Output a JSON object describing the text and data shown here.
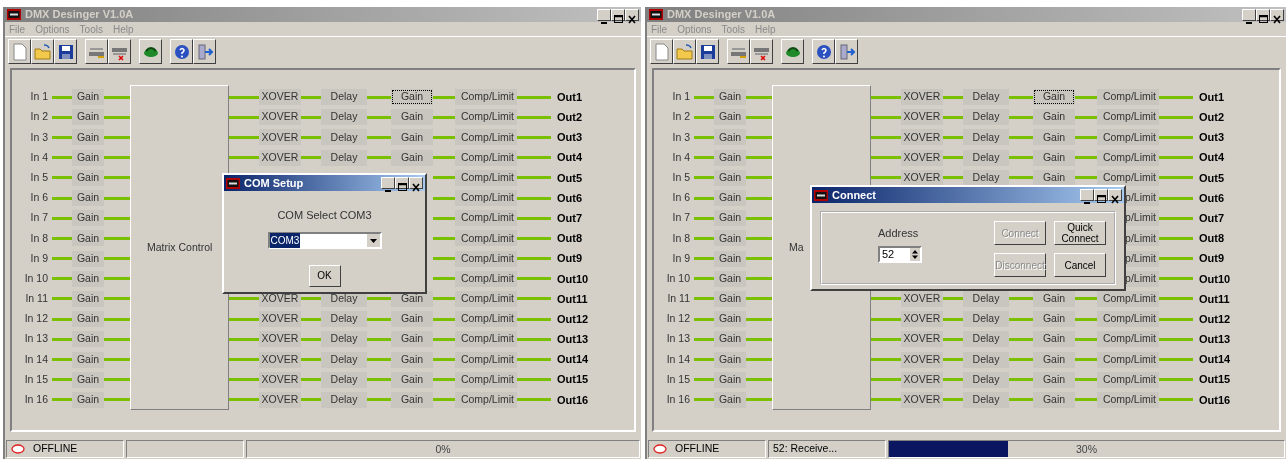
{
  "windows": [
    {
      "title": "DMX Desinger V1.0A",
      "menu": [
        {
          "label": "File",
          "disabled": true
        },
        {
          "label": "Options",
          "disabled": true
        },
        {
          "label": "Tools",
          "disabled": true
        },
        {
          "label": "Help",
          "disabled": true
        }
      ],
      "toolbar": [
        [
          {
            "kind": "new"
          },
          {
            "kind": "open"
          },
          {
            "kind": "save"
          }
        ],
        [
          {
            "kind": "connect"
          },
          {
            "kind": "disconnect"
          }
        ],
        [
          {
            "kind": "transfer"
          }
        ],
        [
          {
            "kind": "help"
          },
          {
            "kind": "exit"
          }
        ]
      ],
      "matrix_label": "Matrix Control",
      "rows": [
        {
          "input": "In 1",
          "gain": "Gain",
          "xover": "XOVER",
          "delay": "Delay",
          "eq_gain": "Gain",
          "eq_gain_focused": true,
          "comp": "Comp/Limit",
          "output": "Out1"
        },
        {
          "input": "In 2",
          "gain": "Gain",
          "xover": "XOVER",
          "delay": "Delay",
          "eq_gain": "Gain",
          "eq_gain_focused": false,
          "comp": "Comp/Limit",
          "output": "Out2"
        },
        {
          "input": "In 3",
          "gain": "Gain",
          "xover": "XOVER",
          "delay": "Delay",
          "eq_gain": "Gain",
          "eq_gain_focused": false,
          "comp": "Comp/Limit",
          "output": "Out3"
        },
        {
          "input": "In 4",
          "gain": "Gain",
          "xover": "XOVER",
          "delay": "Delay",
          "eq_gain": "Gain",
          "eq_gain_focused": false,
          "comp": "Comp/Limit",
          "output": "Out4"
        },
        {
          "input": "In 5",
          "gain": "Gain",
          "comp": "Comp/Limit",
          "output": "Out5"
        },
        {
          "input": "In 6",
          "gain": "Gain",
          "comp": "Comp/Limit",
          "output": "Out6"
        },
        {
          "input": "In 7",
          "gain": "Gain",
          "comp": "Comp/Limit",
          "output": "Out7"
        },
        {
          "input": "In 8",
          "gain": "Gain",
          "comp": "Comp/Limit",
          "output": "Out8"
        },
        {
          "input": "In 9",
          "gain": "Gain",
          "comp": "Comp/Limit",
          "output": "Out9"
        },
        {
          "input": "In 10",
          "gain": "Gain",
          "comp": "Comp/Limit",
          "output": "Out10"
        },
        {
          "input": "In 11",
          "gain": "Gain",
          "xover": "XOVER",
          "delay": "Delay",
          "eq_gain": "Gain",
          "eq_gain_focused": false,
          "comp": "Comp/Limit",
          "output": "Out11"
        },
        {
          "input": "In 12",
          "gain": "Gain",
          "xover": "XOVER",
          "delay": "Delay",
          "eq_gain": "Gain",
          "eq_gain_focused": false,
          "comp": "Comp/Limit",
          "output": "Out12"
        },
        {
          "input": "In 13",
          "gain": "Gain",
          "xover": "XOVER",
          "delay": "Delay",
          "eq_gain": "Gain",
          "eq_gain_focused": false,
          "comp": "Comp/Limit",
          "output": "Out13"
        },
        {
          "input": "In 14",
          "gain": "Gain",
          "xover": "XOVER",
          "delay": "Delay",
          "eq_gain": "Gain",
          "eq_gain_focused": false,
          "comp": "Comp/Limit",
          "output": "Out14"
        },
        {
          "input": "In 15",
          "gain": "Gain",
          "xover": "XOVER",
          "delay": "Delay",
          "eq_gain": "Gain",
          "eq_gain_focused": false,
          "comp": "Comp/Limit",
          "output": "Out15"
        },
        {
          "input": "In 16",
          "gain": "Gain",
          "xover": "XOVER",
          "delay": "Delay",
          "eq_gain": "Gain",
          "eq_gain_focused": false,
          "comp": "Comp/Limit",
          "output": "Out16"
        }
      ],
      "dialog": {
        "kind": "com_setup",
        "title": "COM Setup",
        "label": "COM Select COM3",
        "select": {
          "value": "COM3"
        },
        "buttons": [
          {
            "label": "OK",
            "disabled": false
          }
        ]
      },
      "status": {
        "connection": "OFFLINE",
        "progress_text": "0%",
        "level": 0
      }
    },
    {
      "title": "DMX Desinger V1.0A",
      "menu": [
        {
          "label": "File",
          "disabled": true
        },
        {
          "label": "Options",
          "disabled": true
        },
        {
          "label": "Tools",
          "disabled": true
        },
        {
          "label": "Help",
          "disabled": true
        }
      ],
      "toolbar": [
        [
          {
            "kind": "new"
          },
          {
            "kind": "open"
          },
          {
            "kind": "save"
          }
        ],
        [
          {
            "kind": "connect"
          },
          {
            "kind": "disconnect"
          }
        ],
        [
          {
            "kind": "transfer"
          }
        ],
        [
          {
            "kind": "help"
          },
          {
            "kind": "exit"
          }
        ]
      ],
      "matrix_label": "Ma",
      "rows": [
        {
          "input": "In 1",
          "gain": "Gain",
          "xover": "XOVER",
          "delay": "Delay",
          "eq_gain": "Gain",
          "eq_gain_focused": true,
          "comp": "Comp/Limit",
          "output": "Out1"
        },
        {
          "input": "In 2",
          "gain": "Gain",
          "xover": "XOVER",
          "delay": "Delay",
          "eq_gain": "Gain",
          "eq_gain_focused": false,
          "comp": "Comp/Limit",
          "output": "Out2"
        },
        {
          "input": "In 3",
          "gain": "Gain",
          "xover": "XOVER",
          "delay": "Delay",
          "eq_gain": "Gain",
          "eq_gain_focused": false,
          "comp": "Comp/Limit",
          "output": "Out3"
        },
        {
          "input": "In 4",
          "gain": "Gain",
          "xover": "XOVER",
          "delay": "Delay",
          "eq_gain": "Gain",
          "eq_gain_focused": false,
          "comp": "Comp/Limit",
          "output": "Out4"
        },
        {
          "input": "In 5",
          "gain": "Gain",
          "xover": "XOVER",
          "delay": "Delay",
          "eq_gain": "Gain",
          "eq_gain_focused": false,
          "comp": "Comp/Limit",
          "output": "Out5"
        },
        {
          "input": "In 6",
          "gain": "Gain",
          "comp": "p/Limit",
          "output": "Out6"
        },
        {
          "input": "In 7",
          "gain": "Gain",
          "comp": "p/Limit",
          "output": "Out7"
        },
        {
          "input": "In 8",
          "gain": "Gain",
          "comp": "p/Limit",
          "output": "Out8"
        },
        {
          "input": "In 9",
          "gain": "Gain",
          "comp": "p/Limit",
          "output": "Out9"
        },
        {
          "input": "In 10",
          "gain": "Gain",
          "comp": "p/Limit",
          "output": "Out10"
        },
        {
          "input": "In 11",
          "gain": "Gain",
          "xover": "XOVER",
          "delay": "Delay",
          "eq_gain": "Gain",
          "eq_gain_focused": false,
          "comp": "Comp/Limit",
          "output": "Out11"
        },
        {
          "input": "In 12",
          "gain": "Gain",
          "xover": "XOVER",
          "delay": "Delay",
          "eq_gain": "Gain",
          "eq_gain_focused": false,
          "comp": "Comp/Limit",
          "output": "Out12"
        },
        {
          "input": "In 13",
          "gain": "Gain",
          "xover": "XOVER",
          "delay": "Delay",
          "eq_gain": "Gain",
          "eq_gain_focused": false,
          "comp": "Comp/Limit",
          "output": "Out13"
        },
        {
          "input": "In 14",
          "gain": "Gain",
          "xover": "XOVER",
          "delay": "Delay",
          "eq_gain": "Gain",
          "eq_gain_focused": false,
          "comp": "Comp/Limit",
          "output": "Out14"
        },
        {
          "input": "In 15",
          "gain": "Gain",
          "xover": "XOVER",
          "delay": "Delay",
          "eq_gain": "Gain",
          "eq_gain_focused": false,
          "comp": "Comp/Limit",
          "output": "Out15"
        },
        {
          "input": "In 16",
          "gain": "Gain",
          "xover": "XOVER",
          "delay": "Delay",
          "eq_gain": "Gain",
          "eq_gain_focused": false,
          "comp": "Comp/Limit",
          "output": "Out16"
        }
      ],
      "dialog": {
        "kind": "connect",
        "title": "Connect",
        "label": "Address",
        "spin": {
          "value": "52"
        },
        "buttons": [
          {
            "label": "Connect",
            "disabled": true
          },
          {
            "label": "Quick Connect",
            "disabled": false
          },
          {
            "label": "Disconnect",
            "disabled": true
          },
          {
            "label": "Cancel",
            "disabled": false
          }
        ]
      },
      "status": {
        "connection": "OFFLINE",
        "message": "52: Receive...",
        "progress_text": "30%",
        "level": 0.3
      }
    }
  ]
}
